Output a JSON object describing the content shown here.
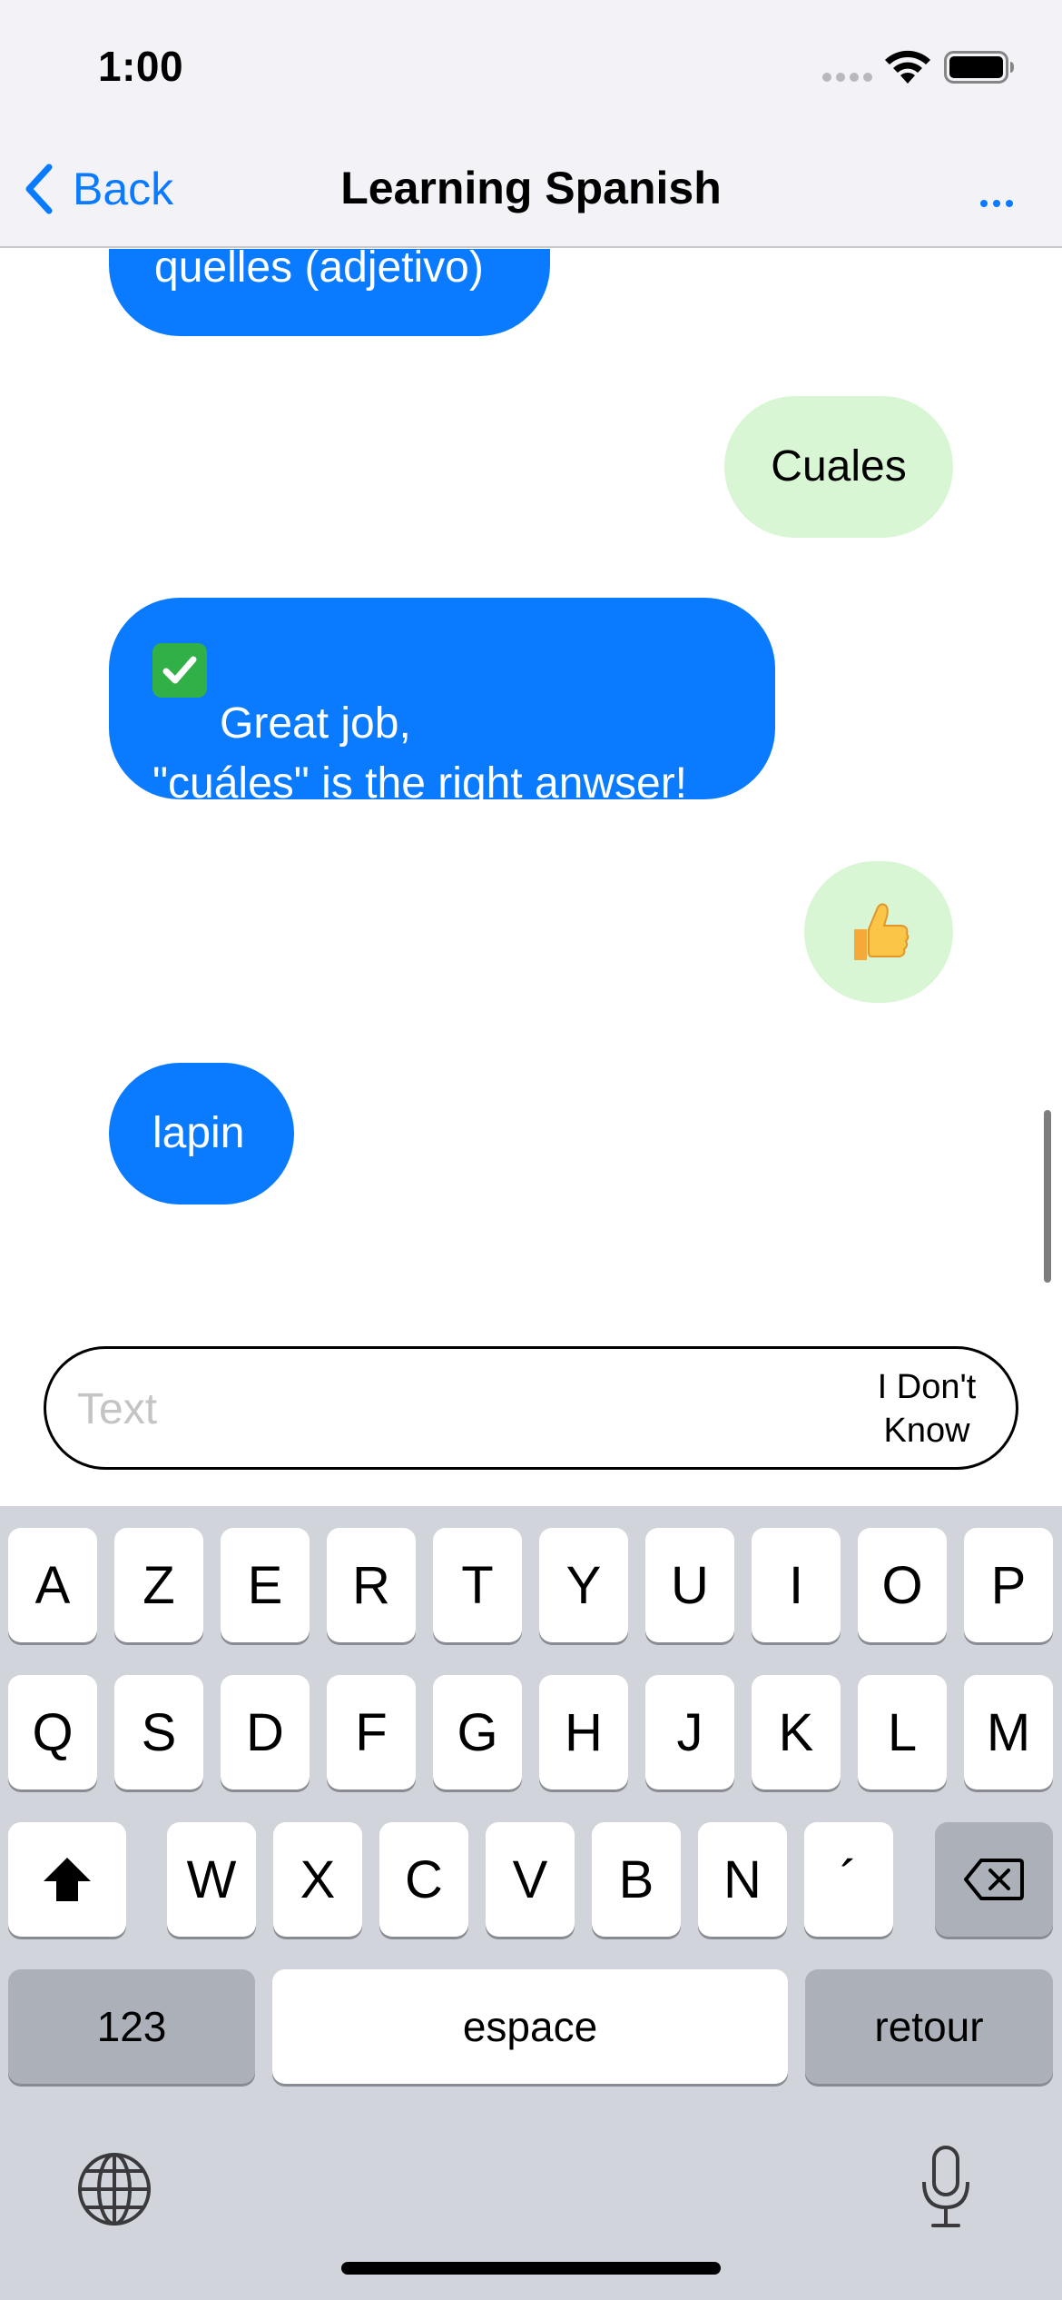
{
  "status_bar": {
    "time": "1:00"
  },
  "nav": {
    "back_label": "Back",
    "title": "Learning Spanish",
    "more_label": "..."
  },
  "messages": [
    {
      "from": "bot",
      "text": "quelles (adjetivo)"
    },
    {
      "from": "me",
      "text": "Cuales"
    },
    {
      "from": "bot",
      "text": "Great job,\n\"cuáles\" is the right anwser!"
    },
    {
      "from": "me",
      "text": "👍"
    },
    {
      "from": "bot",
      "text": "lapin"
    }
  ],
  "composer": {
    "placeholder": "Text",
    "value": "",
    "idk_label": "I Don't\nKnow"
  },
  "keyboard": {
    "row1": [
      "A",
      "Z",
      "E",
      "R",
      "T",
      "Y",
      "U",
      "I",
      "O",
      "P"
    ],
    "row2": [
      "Q",
      "S",
      "D",
      "F",
      "G",
      "H",
      "J",
      "K",
      "L",
      "M"
    ],
    "row3": [
      "W",
      "X",
      "C",
      "V",
      "B",
      "N",
      "´"
    ],
    "numbers_label": "123",
    "space_label": "espace",
    "return_label": "retour"
  },
  "colors": {
    "accent": "#0a7aff",
    "bot_bubble": "#0a7aff",
    "user_bubble": "#d9f6d4",
    "keyboard_bg": "#d1d4da",
    "check_green": "#32b048"
  },
  "icons": [
    "chevron-left-icon",
    "more-icon",
    "signal-icon",
    "wifi-icon",
    "battery-icon",
    "check-mark-icon",
    "thumbs-up-icon",
    "shift-icon",
    "delete-icon",
    "globe-icon",
    "microphone-icon"
  ]
}
